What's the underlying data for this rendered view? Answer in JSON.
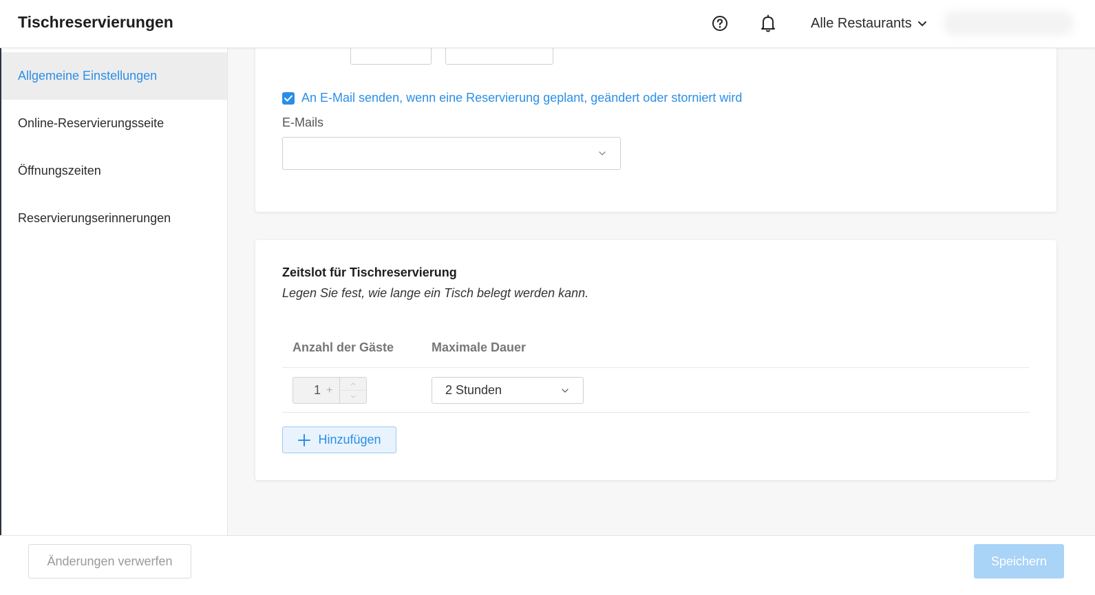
{
  "header": {
    "title": "Tischreservierungen",
    "help_icon": "help-circle-icon",
    "notifications_icon": "bell-icon",
    "restaurant_selector": "Alle Restaurants"
  },
  "sidebar": {
    "items": [
      {
        "label": "Allgemeine Einstellungen",
        "active": true
      },
      {
        "label": "Online-Reservierungsseite",
        "active": false
      },
      {
        "label": "Öffnungszeiten",
        "active": false
      },
      {
        "label": "Reservierungserinnerungen",
        "active": false
      }
    ]
  },
  "notification_settings": {
    "send_email_checkbox_label": "An E-Mail senden, wenn eine Reservierung geplant, geändert oder storniert wird",
    "send_email_checked": true,
    "emails_label": "E-Mails",
    "emails_value": ""
  },
  "timeslot": {
    "title": "Zeitslot für Tischreservierung",
    "subtitle": "Legen Sie fest, wie lange ein Tisch belegt werden kann.",
    "columns": [
      "Anzahl der Gäste",
      "Maximale Dauer"
    ],
    "rows": [
      {
        "guests": "1",
        "guests_suffix": "+",
        "duration": "2 Stunden"
      }
    ],
    "add_button": "Hinzufügen"
  },
  "footer": {
    "discard_button": "Änderungen verwerfen",
    "save_button": "Speichern"
  },
  "colors": {
    "accent": "#2b8ee6",
    "save_disabled": "#a9d3f7"
  }
}
